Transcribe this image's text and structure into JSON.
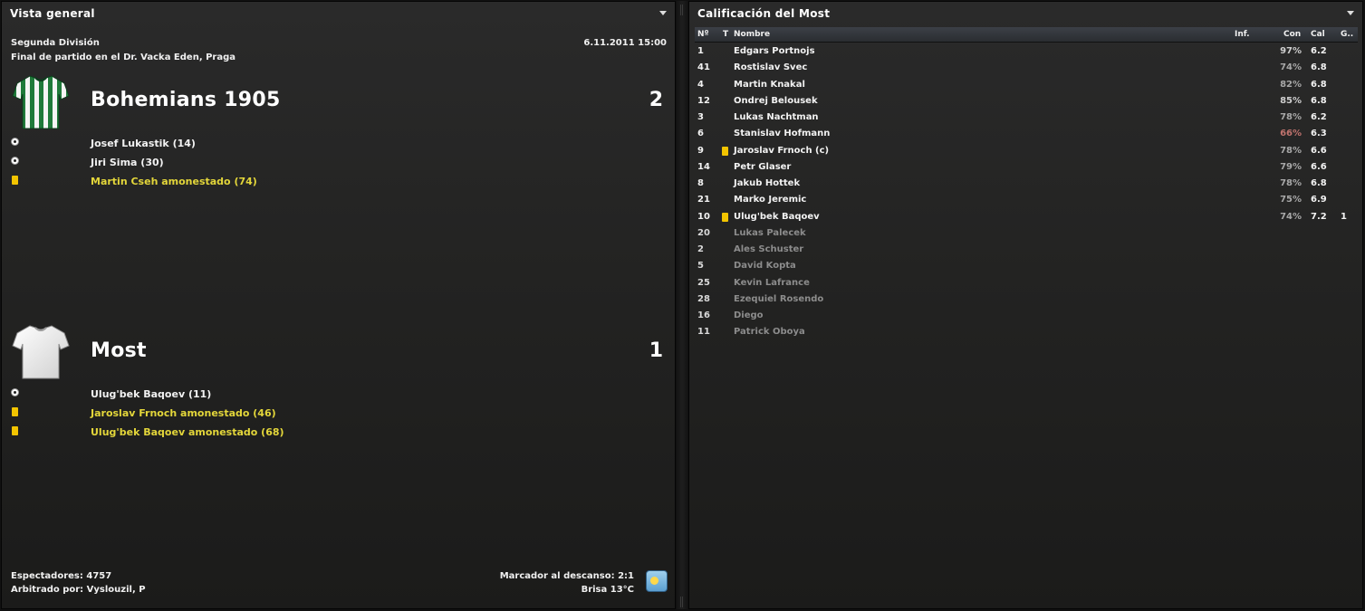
{
  "left_panel": {
    "title": "Vista general",
    "competition": "Segunda División",
    "datetime": "6.11.2011 15:00",
    "venue": "Final de partido en el Dr. Vacka Eden, Praga",
    "home": {
      "name": "Bohemians 1905",
      "score": "2",
      "kit_colors": [
        "#1f7a3a",
        "#ffffff"
      ],
      "events": [
        {
          "icon": "ball-icon",
          "text": "Josef Lukastik (14)",
          "type": "goal"
        },
        {
          "icon": "ball-icon",
          "text": "Jiri Sima (30)",
          "type": "goal"
        },
        {
          "icon": "yellow-card-icon",
          "text": "Martin Cseh amonestado (74)",
          "type": "booking"
        }
      ]
    },
    "away": {
      "name": "Most",
      "score": "1",
      "kit_colors": [
        "#f2f2f2"
      ],
      "events": [
        {
          "icon": "ball-icon",
          "text": "Ulug'bek Baqoev (11)",
          "type": "goal"
        },
        {
          "icon": "yellow-card-icon",
          "text": "Jaroslav Frnoch amonestado (46)",
          "type": "booking"
        },
        {
          "icon": "yellow-card-icon",
          "text": "Ulug'bek Baqoev amonestado (68)",
          "type": "booking"
        }
      ]
    },
    "footer": {
      "attendance": "Espectadores: 4757",
      "referee": "Arbitrado por: Vyslouzil, P",
      "halftime": "Marcador al descanso: 2:1",
      "weather": "Brisa 13°C",
      "weather_icon": "sun-cloud-icon"
    }
  },
  "right_panel": {
    "title": "Calificación del Most",
    "columns": {
      "num": "Nº",
      "t": "T",
      "name": "Nombre",
      "inf": "Inf.",
      "con": "Con",
      "cal": "Cal",
      "g": "G.."
    },
    "players": [
      {
        "num": "1",
        "name": "Edgars Portnojs",
        "con": "97%",
        "cal": "6.2",
        "card": false,
        "g": "",
        "status": "hi"
      },
      {
        "num": "41",
        "name": "Rostislav Svec",
        "con": "74%",
        "cal": "6.8",
        "card": false,
        "g": "",
        "status": ""
      },
      {
        "num": "4",
        "name": "Martin Knakal",
        "con": "82%",
        "cal": "6.8",
        "card": false,
        "g": "",
        "status": ""
      },
      {
        "num": "12",
        "name": "Ondrej Belousek",
        "con": "85%",
        "cal": "6.8",
        "card": false,
        "g": "",
        "status": "hi"
      },
      {
        "num": "3",
        "name": "Lukas Nachtman",
        "con": "78%",
        "cal": "6.2",
        "card": false,
        "g": "",
        "status": ""
      },
      {
        "num": "6",
        "name": "Stanislav Hofmann",
        "con": "66%",
        "cal": "6.3",
        "card": false,
        "g": "",
        "status": "low"
      },
      {
        "num": "9",
        "name": "Jaroslav Frnoch (c)",
        "con": "78%",
        "cal": "6.6",
        "card": true,
        "g": "",
        "status": ""
      },
      {
        "num": "14",
        "name": "Petr Glaser",
        "con": "79%",
        "cal": "6.6",
        "card": false,
        "g": "",
        "status": ""
      },
      {
        "num": "8",
        "name": "Jakub Hottek",
        "con": "78%",
        "cal": "6.8",
        "card": false,
        "g": "",
        "status": ""
      },
      {
        "num": "21",
        "name": "Marko Jeremic",
        "con": "75%",
        "cal": "6.9",
        "card": false,
        "g": "",
        "status": ""
      },
      {
        "num": "10",
        "name": "Ulug'bek Baqoev",
        "con": "74%",
        "cal": "7.2",
        "card": true,
        "g": "1",
        "status": ""
      },
      {
        "num": "20",
        "name": "Lukas Palecek",
        "con": "",
        "cal": "",
        "card": false,
        "g": "",
        "status": "sub"
      },
      {
        "num": "2",
        "name": "Ales Schuster",
        "con": "",
        "cal": "",
        "card": false,
        "g": "",
        "status": "sub"
      },
      {
        "num": "5",
        "name": "David Kopta",
        "con": "",
        "cal": "",
        "card": false,
        "g": "",
        "status": "sub"
      },
      {
        "num": "25",
        "name": "Kevin Lafrance",
        "con": "",
        "cal": "",
        "card": false,
        "g": "",
        "status": "sub"
      },
      {
        "num": "28",
        "name": "Ezequiel Rosendo",
        "con": "",
        "cal": "",
        "card": false,
        "g": "",
        "status": "sub"
      },
      {
        "num": "16",
        "name": "Diego",
        "con": "",
        "cal": "",
        "card": false,
        "g": "",
        "status": "sub"
      },
      {
        "num": "11",
        "name": "Patrick Oboya",
        "con": "",
        "cal": "",
        "card": false,
        "g": "",
        "status": "sub"
      }
    ]
  }
}
